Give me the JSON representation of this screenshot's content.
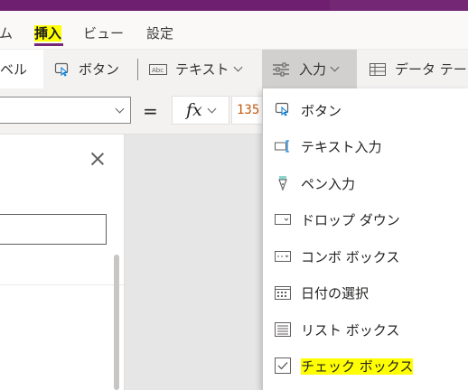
{
  "menubar": {
    "items": [
      {
        "label": "ム"
      },
      {
        "label": "挿入"
      },
      {
        "label": "ビュー"
      },
      {
        "label": "設定"
      }
    ],
    "active": "挿入"
  },
  "toolbar": {
    "label_partial": "ベル",
    "button_label": "ボタン",
    "text_label": "テキスト",
    "input_label": "入力",
    "data_table_label": "データ テー"
  },
  "formula_bar": {
    "equals": "=",
    "fx_label": "fx",
    "formula_value": "135"
  },
  "insert_input_menu": {
    "items": [
      {
        "label": "ボタン",
        "icon": "button-icon"
      },
      {
        "label": "テキスト入力",
        "icon": "text-input-icon"
      },
      {
        "label": "ペン入力",
        "icon": "pen-input-icon"
      },
      {
        "label": "ドロップ ダウン",
        "icon": "dropdown-icon"
      },
      {
        "label": "コンボ ボックス",
        "icon": "combo-box-icon"
      },
      {
        "label": "日付の選択",
        "icon": "date-picker-icon"
      },
      {
        "label": "リスト ボックス",
        "icon": "list-box-icon"
      },
      {
        "label": "チェック ボックス",
        "icon": "checkbox-icon"
      }
    ]
  },
  "colors": {
    "accent": "#742774",
    "highlight": "#ffff00",
    "formula_text": "#c55a11"
  }
}
